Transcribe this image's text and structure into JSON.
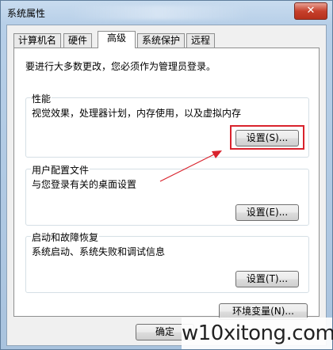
{
  "window": {
    "title": "系统属性",
    "close_glyph": "✕"
  },
  "tabs": [
    {
      "label": "计算机名",
      "active": false
    },
    {
      "label": "硬件",
      "active": false
    },
    {
      "label": "高级",
      "active": true
    },
    {
      "label": "系统保护",
      "active": false
    },
    {
      "label": "远程",
      "active": false
    }
  ],
  "notice": "要进行大多数更改，您必须作为管理员登录。",
  "performance": {
    "title": "性能",
    "desc": "视觉效果，处理器计划，内存使用，以及虚拟内存",
    "button": "设置(S)..."
  },
  "profile": {
    "title": "用户配置文件",
    "desc": "与您登录有关的桌面设置",
    "button": "设置(E)..."
  },
  "startup": {
    "title": "启动和故障恢复",
    "desc": "系统启动、系统失败和调试信息",
    "button": "设置(T)..."
  },
  "env_button": "环境变量(N)...",
  "footer": {
    "ok_label": "确定"
  },
  "watermark": "w10xitong.com",
  "colors": {
    "highlight": "#d9232d",
    "arrow": "#d9232d"
  }
}
